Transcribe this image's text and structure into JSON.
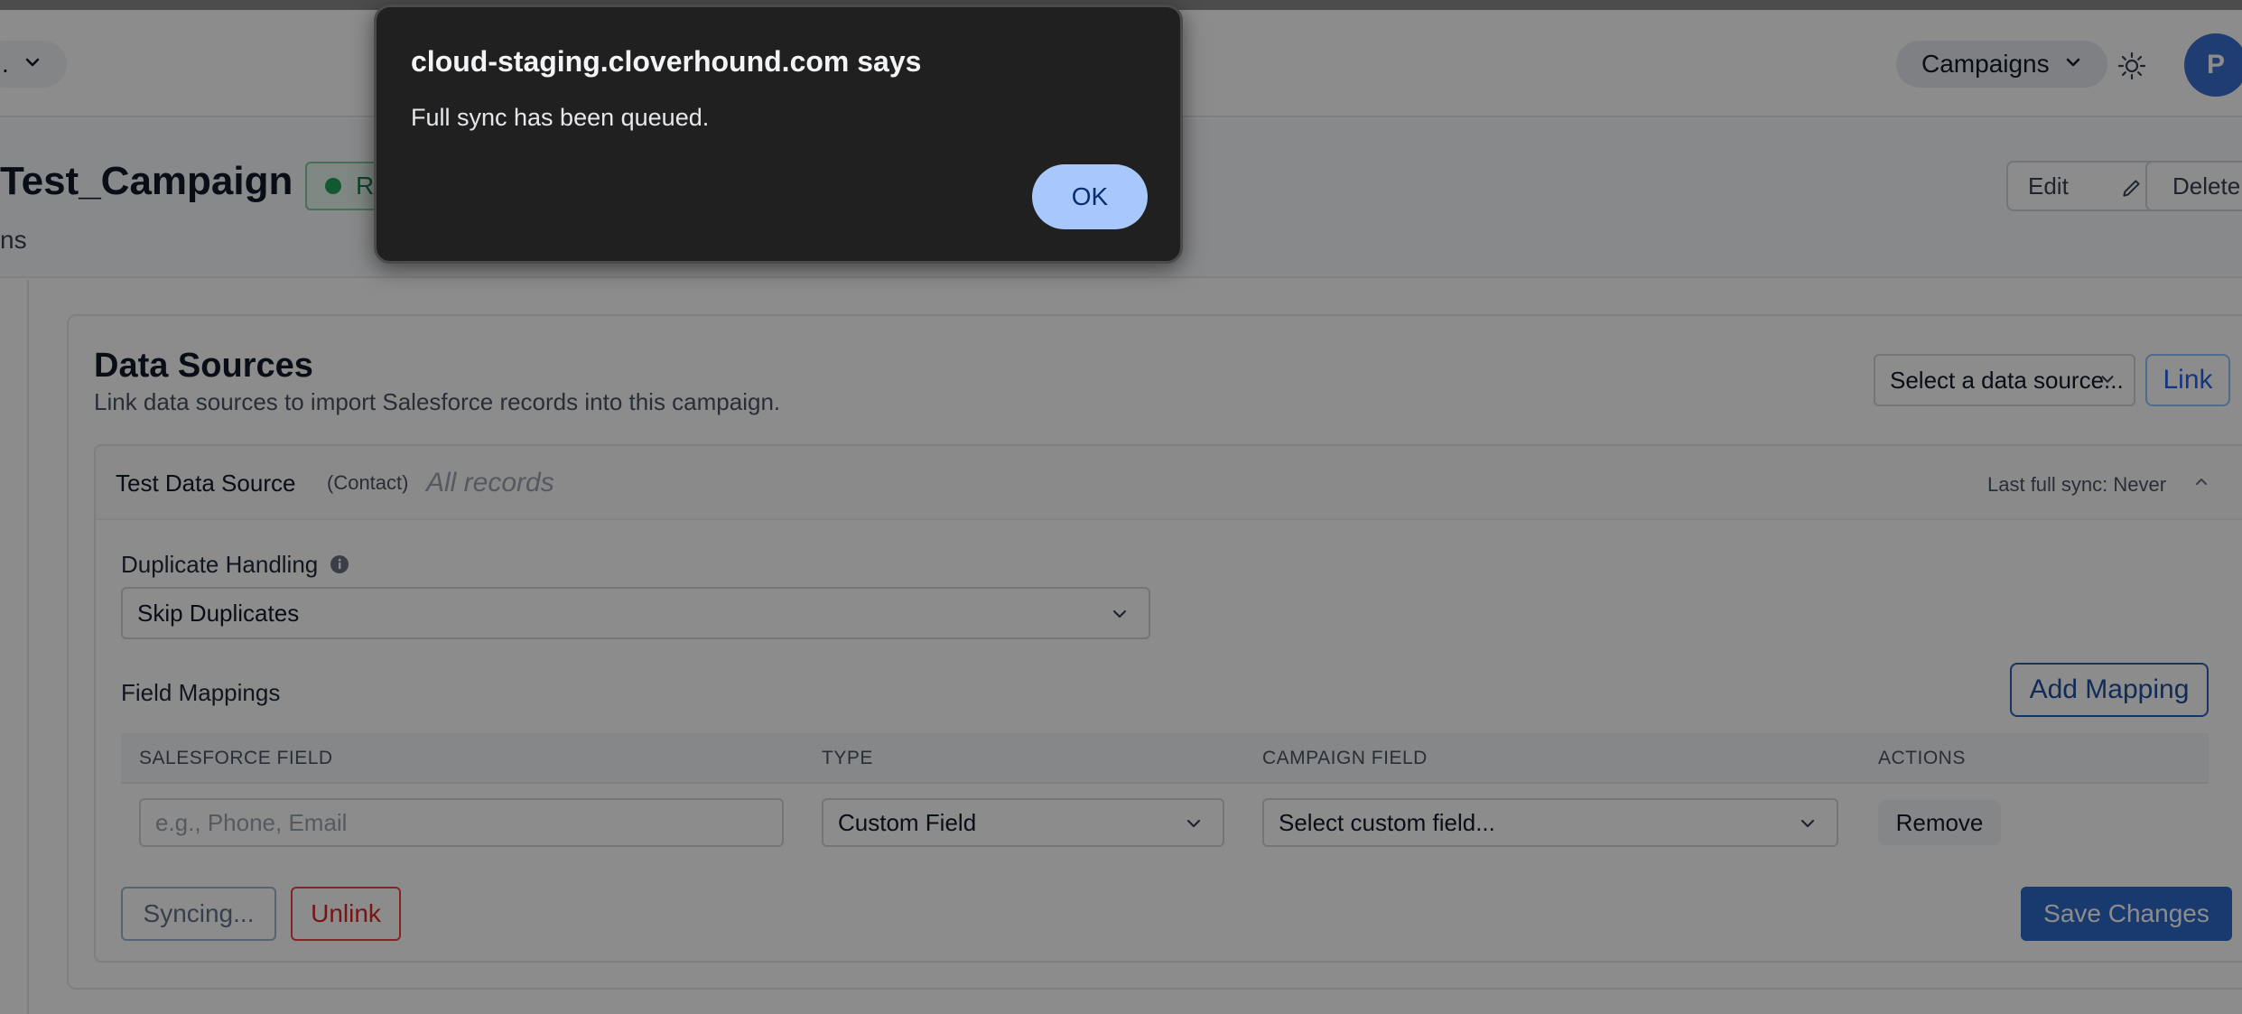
{
  "header": {
    "org_selector": ".",
    "nav_selector": "Campaigns",
    "theme_icon": "sun-icon",
    "avatar_initial": "P"
  },
  "campaign": {
    "title": "Test_Campaign",
    "status": "R",
    "subtitle": "ns",
    "edit_label": "Edit",
    "delete_label": "Delete"
  },
  "data_sources": {
    "title": "Data Sources",
    "description": "Link data sources to import Salesforce records into this campaign.",
    "select_placeholder": "Select a data source...",
    "link_label": "Link",
    "source": {
      "name": "Test Data Source",
      "object": "(Contact)",
      "scope": "All records",
      "last_sync": "Last full sync: Never",
      "duplicate_label": "Duplicate Handling",
      "duplicate_value": "Skip Duplicates",
      "field_mappings_label": "Field Mappings",
      "add_mapping_label": "Add Mapping",
      "columns": [
        "SALESFORCE FIELD",
        "TYPE",
        "CAMPAIGN FIELD",
        "ACTIONS"
      ],
      "row": {
        "sf_placeholder": "e.g., Phone, Email",
        "type_value": "Custom Field",
        "campaign_field_value": "Select custom field...",
        "remove_label": "Remove"
      },
      "syncing_label": "Syncing...",
      "unlink_label": "Unlink",
      "save_label": "Save Changes"
    }
  },
  "dialog": {
    "title": "cloud-staging.cloverhound.com says",
    "message": "Full sync has been queued.",
    "ok_label": "OK"
  },
  "colors": {
    "accent": "#2f6bc9",
    "danger": "#dc2626",
    "dialog_bg": "#202020",
    "ok_button": "#a8c7fa"
  }
}
